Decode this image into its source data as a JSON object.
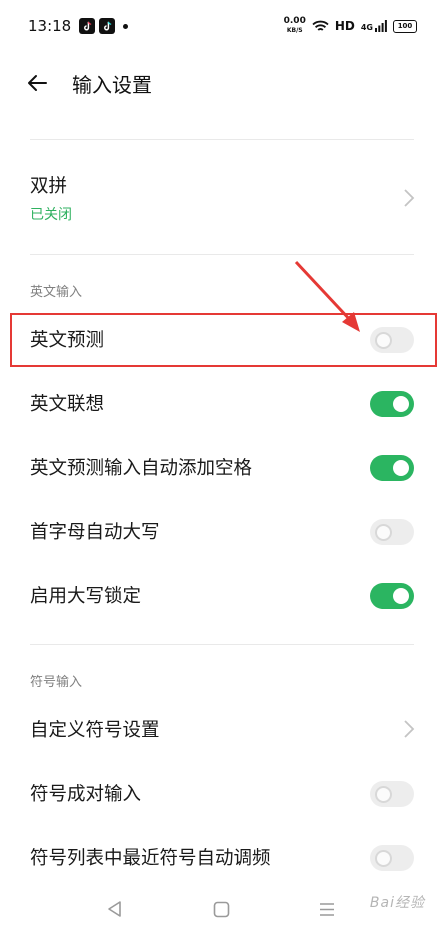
{
  "status_bar": {
    "time": "13:18",
    "net_speed_value": "0.00",
    "net_speed_unit": "KB/S",
    "hd": "HD",
    "signal": "4G",
    "battery": "100"
  },
  "header": {
    "title": "输入设置"
  },
  "double_pinyin": {
    "label": "双拼",
    "status": "已关闭"
  },
  "english_section": {
    "title": "英文输入",
    "items": [
      {
        "label": "英文预测",
        "on": false
      },
      {
        "label": "英文联想",
        "on": true
      },
      {
        "label": "英文预测输入自动添加空格",
        "on": true
      },
      {
        "label": "首字母自动大写",
        "on": false
      },
      {
        "label": "启用大写锁定",
        "on": true
      }
    ]
  },
  "symbol_section": {
    "title": "符号输入",
    "custom_symbol_label": "自定义符号设置",
    "items": [
      {
        "label": "符号成对输入",
        "on": false
      },
      {
        "label": "符号列表中最近符号自动调频",
        "on": false
      }
    ]
  },
  "watermark": "Bai经验",
  "colors": {
    "accent_green": "#2bb561",
    "annotation_red": "#e53935"
  }
}
